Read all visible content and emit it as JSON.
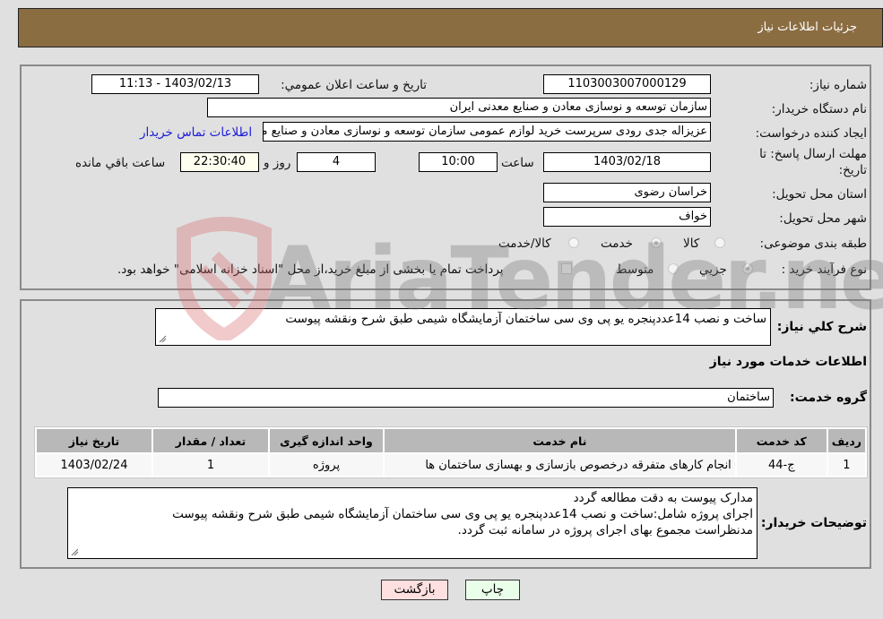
{
  "header": {
    "title": "جزئیات اطلاعات نیاز"
  },
  "form": {
    "need_number": {
      "label": "شماره نیاز:",
      "value": "1103003007000129"
    },
    "announce_datetime": {
      "label": "تاریخ و ساعت اعلان عمومي:",
      "value": "1403/02/13 - 11:13"
    },
    "buyer_org": {
      "label": "نام دستگاه خريدار:",
      "value": "سازمان توسعه و نوسازی معادن و صنایع معدنی ایران"
    },
    "requester": {
      "label": "ایجاد کننده درخواست:",
      "value": "عزیزاله جدی رودی سرپرست خرید لوازم عمومی  سازمان توسعه و نوسازی معادن و صنایع معدنی ایران",
      "contact_link": "اطلاعات تماس خریدار"
    },
    "deadline": {
      "label_line1": "مهلت ارسال پاسخ: تا",
      "label_line2": "تاریخ:",
      "date": "1403/02/18",
      "time_label": "ساعت",
      "time": "10:00",
      "days": "4",
      "days_label": "روز و",
      "remaining": "22:30:40",
      "remaining_label": "ساعت باقي مانده"
    },
    "province": {
      "label": "استان محل تحویل:",
      "value": "خراسان رضوی"
    },
    "city": {
      "label": "شهر محل تحویل:",
      "value": "خواف"
    },
    "category": {
      "label": "طبقه بندی موضوعی:",
      "options": [
        {
          "label": "کالا",
          "selected": false
        },
        {
          "label": "خدمت",
          "selected": true
        },
        {
          "label": "کالا/خدمت",
          "selected": false
        }
      ]
    },
    "process_type": {
      "label": "نوع فرآیند خرید :",
      "options": [
        {
          "label": "جزيي",
          "selected": true
        },
        {
          "label": "متوسط",
          "selected": false
        }
      ],
      "treasury_note": "پرداخت تمام یا بخشی از مبلغ خرید،از محل \"اسناد خزانه اسلامی\" خواهد بود."
    }
  },
  "details": {
    "summary_label": "شرح کلي نياز:",
    "summary_value": "ساخت و نصب 14عددپنجره یو پی وی سی ساختمان آزمایشگاه شیمی طبق شرح ونقشه پیوست",
    "services_heading": "اطلاعات خدمات مورد نیاز",
    "service_group_label": "گروه خدمت:",
    "service_group_value": "ساختمان",
    "table": {
      "headers": [
        "ردیف",
        "کد خدمت",
        "نام خدمت",
        "واحد اندازه گیری",
        "تعداد / مقدار",
        "تاریخ نیاز"
      ],
      "rows": [
        [
          "1",
          "ج-44",
          "انجام کارهای متفرقه درخصوص بازسازی و بهسازی ساختمان ها",
          "پروژه",
          "1",
          "1403/02/24"
        ]
      ]
    },
    "buyer_notes_label": "توضیحات خریدار:",
    "buyer_notes_lines": [
      "مدارک پیوست به دقت مطالعه گردد",
      "اجرای پروژه شامل:ساخت و نصب 14عددپنجره یو پی وی سی ساختمان آزمایشگاه شیمی طبق شرح ونقشه پیوست",
      "مدنظراست مجموع بهای اجرای پروژه در سامانه ثبت گردد."
    ]
  },
  "buttons": {
    "print": "چاپ",
    "back": "بازگشت"
  },
  "colors": {
    "header_bg": "#8b6d42",
    "print_bg": "#eaffea",
    "back_bg": "#ffe0e0",
    "link": "#1a1adb"
  },
  "watermark": {
    "text": "AriaTender.neT"
  }
}
